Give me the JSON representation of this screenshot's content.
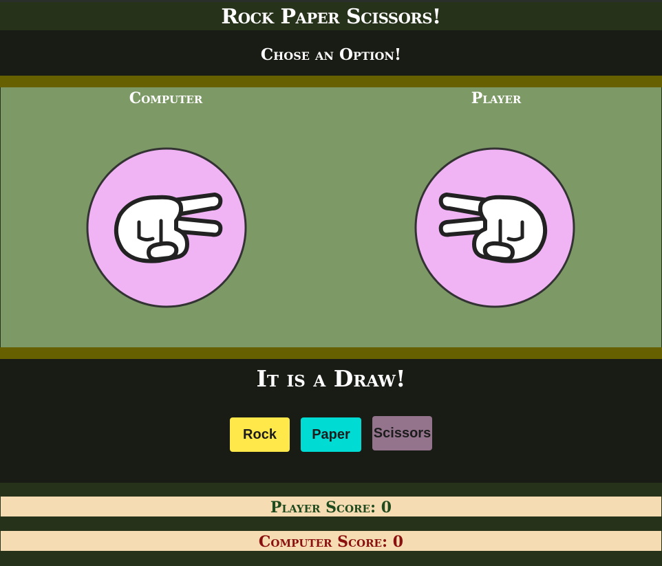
{
  "header": {
    "title": "Rock Paper Scissors!",
    "subtitle": "Chose an Option!"
  },
  "arena": {
    "computer_label": "Computer",
    "player_label": "Player",
    "computer_choice_icon": "scissors-hand-icon",
    "player_choice_icon": "scissors-hand-icon"
  },
  "result": {
    "message": "It is a Draw!"
  },
  "buttons": {
    "rock": "Rock",
    "paper": "Paper",
    "scissors": "Scissors"
  },
  "scores": {
    "player": "Player Score: 0",
    "computer": "Computer Score: 0"
  },
  "colors": {
    "rock_button": "#ffe84a",
    "paper_button": "#00dcd3",
    "scissors_button": "#94748c",
    "choice_circle": "#f0b4f4",
    "arena_background": "#7d9966",
    "band": "#666000",
    "player_score_text": "#1f4a1d",
    "computer_score_text": "#8a0f0f"
  }
}
